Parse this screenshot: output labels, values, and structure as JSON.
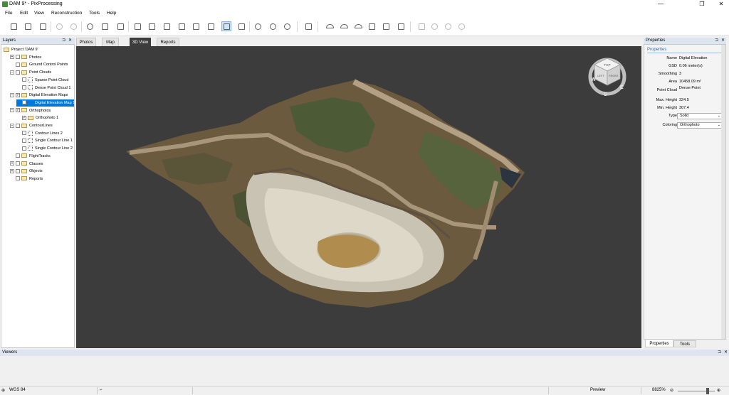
{
  "window": {
    "title": "DAM 9* - PixProcessing",
    "minimize": "—",
    "maximize": "❐",
    "close": "✕"
  },
  "menu": [
    "File",
    "Edit",
    "View",
    "Reconstruction",
    "Tools",
    "Help"
  ],
  "layers_panel": {
    "title": "Layers",
    "pin": "⊐",
    "close": "✕",
    "tree": [
      {
        "label": "Project 'DAM 9'",
        "indent": 0,
        "type": "root",
        "checked": false,
        "expander": ""
      },
      {
        "label": "Photos",
        "indent": 1,
        "type": "folder",
        "checked": false,
        "expander": "+"
      },
      {
        "label": "Ground Control Points",
        "indent": 1,
        "type": "folder",
        "checked": false,
        "expander": ""
      },
      {
        "label": "Point Clouds",
        "indent": 1,
        "type": "folder",
        "checked": false,
        "expander": "−"
      },
      {
        "label": "Sparse Point Cloud",
        "indent": 2,
        "type": "leaf",
        "checked": false,
        "expander": ""
      },
      {
        "label": "Dense Point Cloud 1",
        "indent": 2,
        "type": "leaf",
        "checked": false,
        "expander": ""
      },
      {
        "label": "Digital Elevation Maps",
        "indent": 1,
        "type": "folder",
        "checked": true,
        "expander": "−"
      },
      {
        "label": "Digital Elevation Map 1",
        "indent": 2,
        "type": "leaf",
        "checked": true,
        "expander": "",
        "selected": true
      },
      {
        "label": "Orthophotos",
        "indent": 1,
        "type": "folder",
        "checked": true,
        "expander": "−"
      },
      {
        "label": "Orthophoto 1",
        "indent": 2,
        "type": "folder",
        "checked": true,
        "expander": ""
      },
      {
        "label": "ContourLines",
        "indent": 1,
        "type": "folder",
        "checked": false,
        "expander": "−"
      },
      {
        "label": "Contour Lines 2",
        "indent": 2,
        "type": "leaf",
        "checked": false,
        "expander": ""
      },
      {
        "label": "Single Contour Line 1",
        "indent": 2,
        "type": "leaf",
        "checked": false,
        "expander": ""
      },
      {
        "label": "Single Contour Line 2",
        "indent": 2,
        "type": "leaf",
        "checked": false,
        "expander": ""
      },
      {
        "label": "FlightTracks",
        "indent": 1,
        "type": "folder",
        "checked": false,
        "expander": ""
      },
      {
        "label": "Classes",
        "indent": 1,
        "type": "folder",
        "checked": false,
        "expander": "+"
      },
      {
        "label": "Objects",
        "indent": 1,
        "type": "folder",
        "checked": false,
        "expander": "+"
      },
      {
        "label": "Reports",
        "indent": 1,
        "type": "folder",
        "checked": false,
        "expander": ""
      }
    ]
  },
  "view_tabs": [
    "Photos",
    "Map",
    "3D View",
    "Reports"
  ],
  "active_view_tab": "3D View",
  "view_cube": {
    "top": "TOP",
    "front": "FRONT",
    "left": "LEFT",
    "compass_w": "W",
    "compass_s": "S",
    "compass_e": "E"
  },
  "properties_panel": {
    "title": "Properties",
    "pin": "⊐",
    "close": "✕",
    "section": "Properties",
    "rows": [
      {
        "key": "Name",
        "value": "Digital Elevation"
      },
      {
        "key": "GSD",
        "value": "0.06 meter(s)"
      },
      {
        "key": "Smoothing",
        "value": "3"
      },
      {
        "key": "Area",
        "value": "10458.09 m²"
      },
      {
        "key": "Point Cloud",
        "value": "Dense Point"
      },
      {
        "key": "Max. Height",
        "value": "324.5"
      },
      {
        "key": "Min. Height",
        "value": "307.4"
      }
    ],
    "type_label": "Type",
    "type_value": "Solid",
    "coloring_label": "Coloring",
    "coloring_value": "Orthophoto",
    "bottom_tabs": [
      "Properties",
      "Tools"
    ]
  },
  "viewers_panel": {
    "title": "Viewers",
    "pin": "⊐",
    "close": "✕"
  },
  "status": {
    "crs": "WGS 84",
    "mode": "Preview",
    "zoom": "8825%"
  },
  "colors": {
    "viewport_bg": "#3c3c3c",
    "selection": "#0078d7",
    "panel_header": "#dde6f0",
    "accent_text": "#2e6dba"
  }
}
